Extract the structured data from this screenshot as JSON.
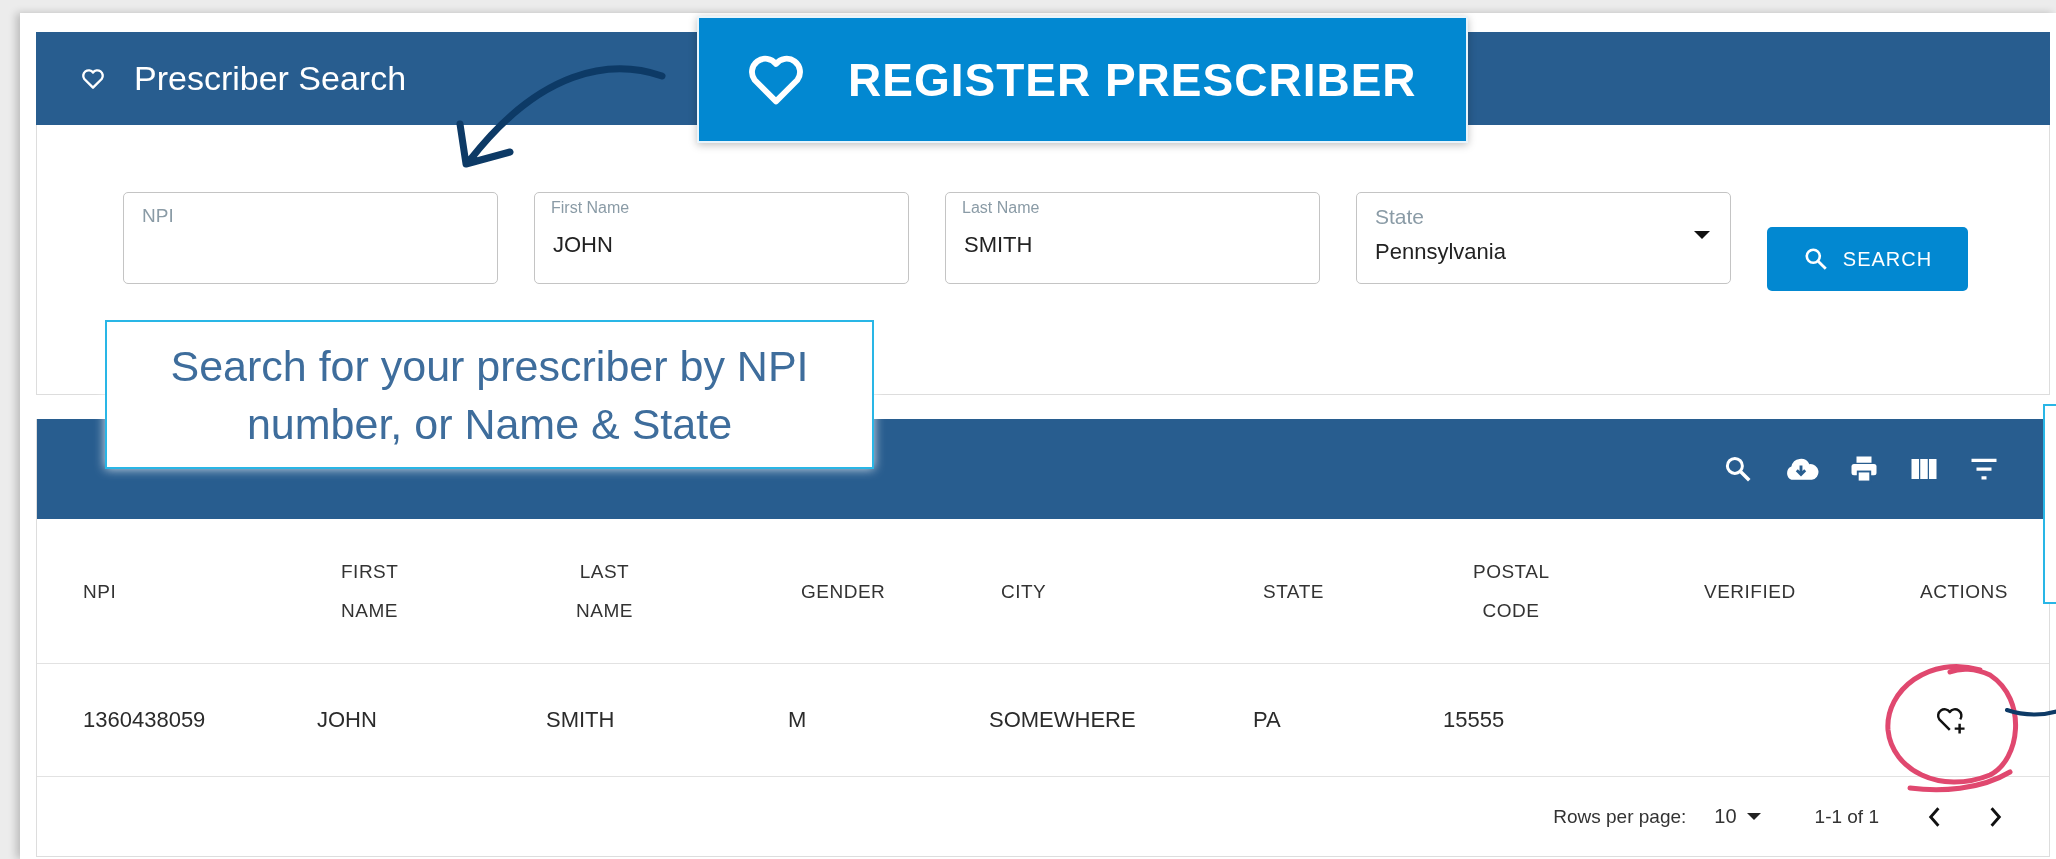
{
  "header": {
    "title": "Prescriber Search"
  },
  "callouts": [
    {
      "kind": "banner",
      "text": "REGISTER PRESCRIBER"
    },
    {
      "kind": "note",
      "text": "Search for your prescriber by NPI number, or Name & State"
    }
  ],
  "search_form": {
    "fields": [
      {
        "kind": "text",
        "label": "NPI"
      },
      {
        "kind": "text",
        "label": "First Name",
        "value": "JOHN"
      },
      {
        "kind": "text",
        "label": "Last Name",
        "value": "SMITH"
      },
      {
        "kind": "select",
        "label": "State",
        "value": "Pennsylvania"
      }
    ],
    "button": "SEARCH"
  },
  "table": {
    "columns": [
      "NPI",
      "FIRST NAME",
      "LAST NAME",
      "GENDER",
      "CITY",
      "STATE",
      "POSTAL CODE",
      "VERIFIED",
      "ACTIONS"
    ],
    "rows": [
      {
        "cells": [
          "1360438059",
          "JOHN",
          "SMITH",
          "M",
          "SOMEWHERE",
          "PA",
          "15555"
        ]
      }
    ],
    "footer": {
      "rows_per_page_label": "Rows per page:",
      "rows_per_page": "10",
      "range": "1-1 of 1"
    }
  }
}
